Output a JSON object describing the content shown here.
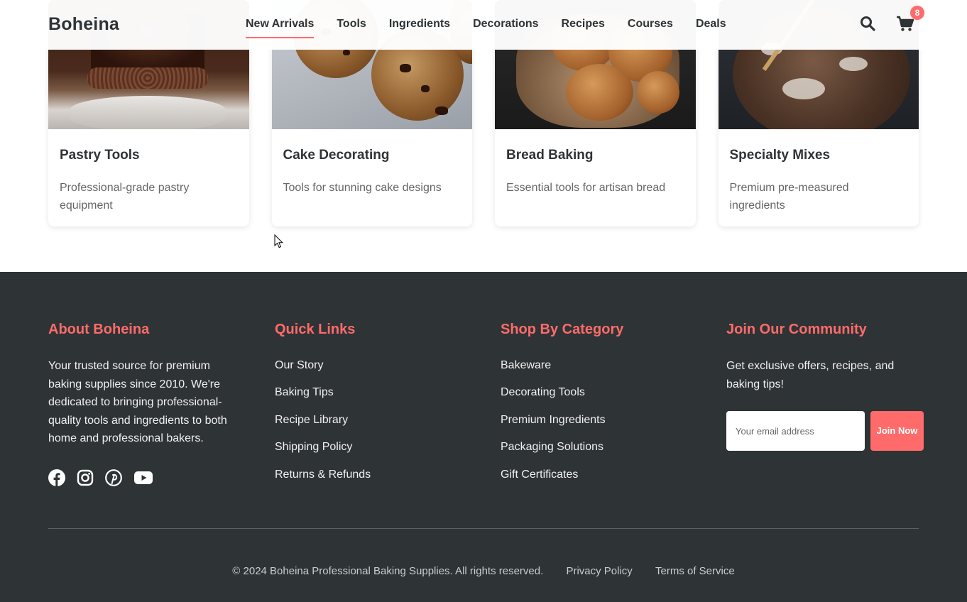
{
  "header": {
    "logo": "Boheina",
    "nav": [
      "New Arrivals",
      "Tools",
      "Ingredients",
      "Decorations",
      "Recipes",
      "Courses",
      "Deals"
    ],
    "active_nav": "New Arrivals",
    "cart_count": "8",
    "icons": {
      "search": "search-icon",
      "cart": "shopping-cart-icon"
    }
  },
  "cards": [
    {
      "title": "Pastry Tools",
      "desc": "Professional-grade pastry equipment"
    },
    {
      "title": "Cake Decorating",
      "desc": "Tools for stunning cake designs"
    },
    {
      "title": "Bread Baking",
      "desc": "Essential tools for artisan bread"
    },
    {
      "title": "Specialty Mixes",
      "desc": "Premium pre-measured ingredients"
    }
  ],
  "footer": {
    "about": {
      "heading": "About Boheina",
      "text": "Your trusted source for premium baking supplies since 2010. We're dedicated to bringing professional-quality tools and ingredients to both home and professional bakers.",
      "social": [
        "facebook-icon",
        "instagram-icon",
        "pinterest-icon",
        "youtube-icon"
      ]
    },
    "quick_links": {
      "heading": "Quick Links",
      "items": [
        "Our Story",
        "Baking Tips",
        "Recipe Library",
        "Shipping Policy",
        "Returns & Refunds"
      ]
    },
    "shop_by_category": {
      "heading": "Shop By Category",
      "items": [
        "Bakeware",
        "Decorating Tools",
        "Premium Ingredients",
        "Packaging Solutions",
        "Gift Certificates"
      ]
    },
    "community": {
      "heading": "Join Our Community",
      "text": "Get exclusive offers, recipes, and baking tips!",
      "email_placeholder": "Your email address",
      "join_label": "Join Now"
    },
    "copyright": "© 2024 Boheina Professional Baking Supplies. All rights reserved.",
    "privacy": "Privacy Policy",
    "terms": "Terms of Service"
  },
  "colors": {
    "accent": "#ff6b6b",
    "footer_bg": "#2e3335",
    "text_dark": "#2f3336"
  }
}
